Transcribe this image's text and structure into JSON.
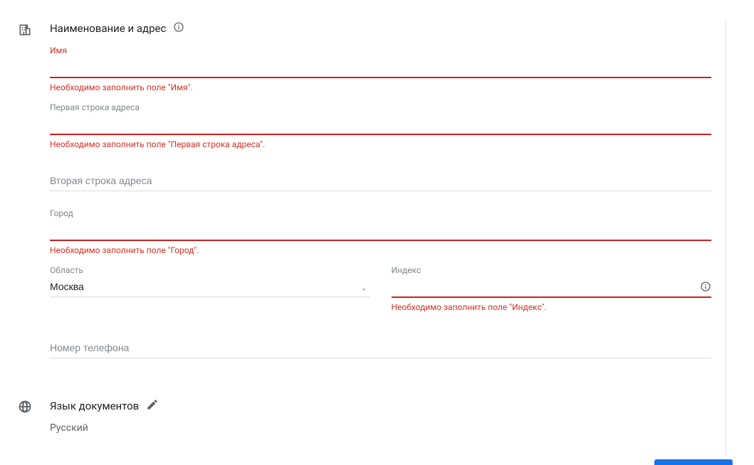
{
  "sections": {
    "name_address": {
      "title": "Наименование и адрес",
      "fields": {
        "name": {
          "label": "Имя",
          "value": "",
          "error": "Необходимо заполнить поле \"Имя\"."
        },
        "address1": {
          "label": "Первая строка адреса",
          "value": "",
          "error": "Необходимо заполнить поле \"Первая строка адреса\"."
        },
        "address2": {
          "placeholder": "Вторая строка адреса",
          "value": ""
        },
        "city": {
          "label": "Город",
          "value": "",
          "error": "Необходимо заполнить поле \"Город\"."
        },
        "region": {
          "label": "Область",
          "value": "Москва"
        },
        "index": {
          "label": "Индекс",
          "value": "",
          "error": "Необходимо заполнить поле \"Индекс\"."
        },
        "phone": {
          "placeholder": "Номер телефона",
          "value": ""
        }
      }
    },
    "doc_language": {
      "title": "Язык документов",
      "value": "Русский"
    }
  }
}
